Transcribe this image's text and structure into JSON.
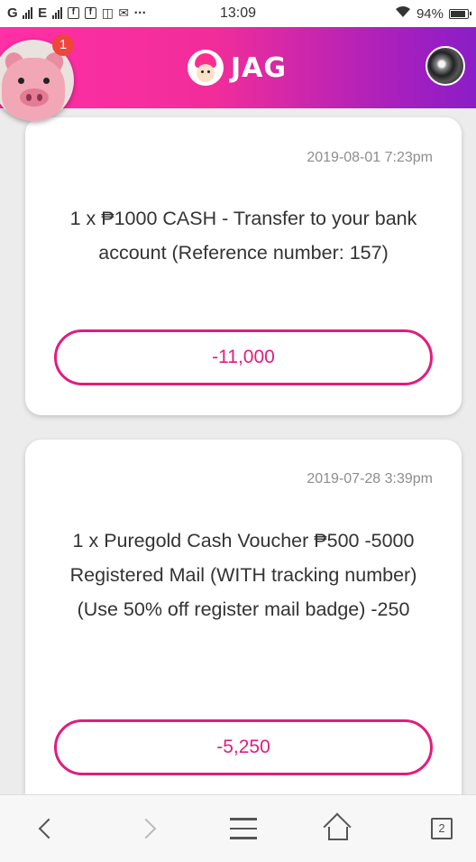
{
  "status_bar": {
    "carrier_left": "G",
    "carrier_right": "E",
    "app_icon_1": "f",
    "app_icon_2": "f",
    "more": "···",
    "time": "13:09",
    "battery_percent": "94%",
    "battery_level": 0.94
  },
  "header": {
    "logo_text": "JAG",
    "notification_count": "1"
  },
  "transactions": [
    {
      "date": "2019-08-01 7:23pm",
      "description": "1 x ₱1000 CASH - Transfer to your bank account (Reference number: 157)",
      "amount": "-11,000"
    },
    {
      "date": "2019-07-28 3:39pm",
      "description": "1 x Puregold Cash Voucher ₱500 -5000 Registered Mail (WITH tracking number) (Use 50% off register mail badge) -250",
      "amount": "-5,250"
    }
  ],
  "bottom_nav": {
    "tabs_count": "2",
    "icons": [
      "back-icon",
      "forward-icon",
      "menu-icon",
      "home-icon",
      "tabs-icon"
    ]
  },
  "colors": {
    "accent": "#e21c7d",
    "header_start": "#ff2fa5",
    "header_end": "#8a1ec6",
    "badge": "#f0453c"
  }
}
